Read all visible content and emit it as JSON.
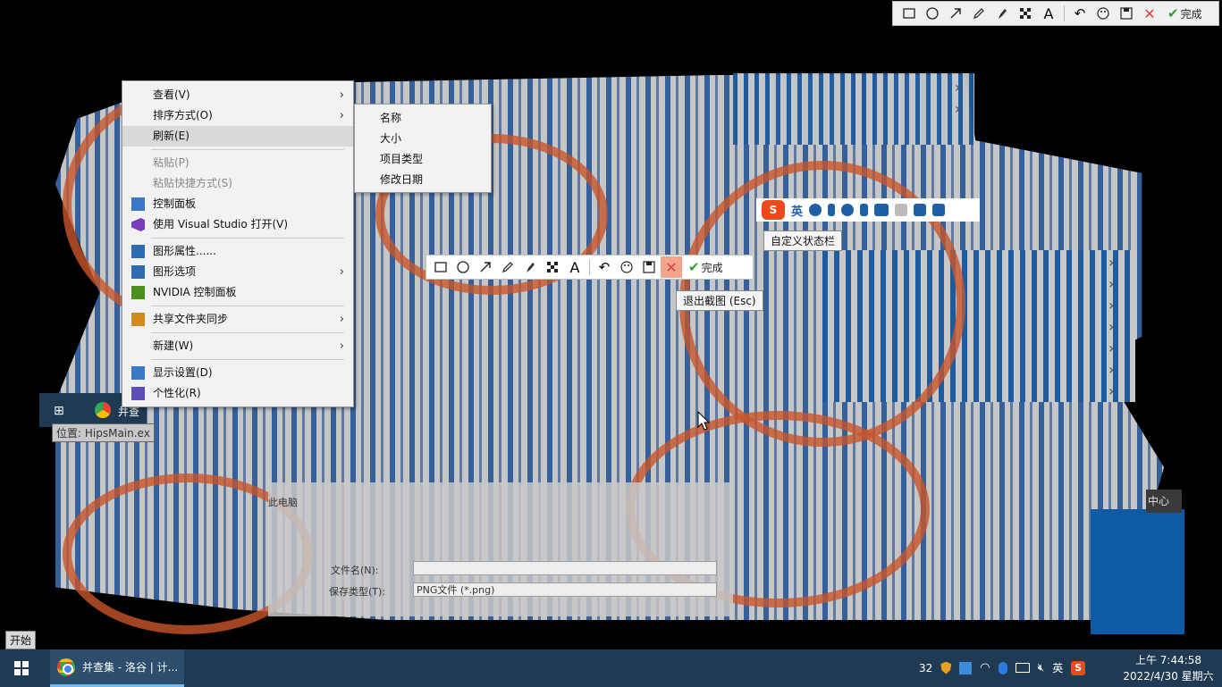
{
  "screenshot_toolbar_top": {
    "tools": [
      "rectangle-icon",
      "ellipse-icon",
      "arrow-icon",
      "pencil-icon",
      "marker-icon",
      "mosaic-icon",
      "text-icon",
      "undo-icon",
      "palette-icon",
      "save-icon",
      "close-icon"
    ],
    "done_label": "完成"
  },
  "context_menu": {
    "items": [
      {
        "label": "查看(V)",
        "submenu": true
      },
      {
        "label": "排序方式(O)",
        "submenu": true
      },
      {
        "label": "刷新(E)"
      },
      {
        "label": "粘贴(P)",
        "disabled": true
      },
      {
        "label": "粘贴快捷方式(S)",
        "disabled": true
      },
      {
        "label": "控制面板",
        "icon": "control-panel-icon"
      },
      {
        "label": "使用 Visual Studio 打开(V)",
        "icon": "visual-studio-icon"
      },
      {
        "label": "图形属性......",
        "icon": "graphics-properties-icon"
      },
      {
        "label": "图形选项",
        "icon": "graphics-options-icon",
        "submenu": true
      },
      {
        "label": "NVIDIA 控制面板",
        "icon": "nvidia-icon"
      },
      {
        "label": "共享文件夹同步",
        "icon": "shared-folder-sync-icon",
        "submenu": true
      },
      {
        "label": "新建(W)",
        "submenu": true
      },
      {
        "label": "显示设置(D)",
        "icon": "display-settings-icon"
      },
      {
        "label": "个性化(R)",
        "icon": "personalize-icon"
      }
    ]
  },
  "sort_submenu": {
    "items": [
      "名称",
      "大小",
      "项目类型",
      "修改日期"
    ]
  },
  "ime_bar": {
    "lang": "英",
    "tooltip": "自定义状态栏"
  },
  "capture_toolbar": {
    "done_label": "完成",
    "close_tooltip": "退出截图 (Esc)"
  },
  "save_dialog": {
    "filename_label": "文件名(N):",
    "filetype_label": "保存类型(T):",
    "filetype_value": "PNG文件 (*.png)",
    "top_label": "此电脑"
  },
  "background_fragments": {
    "start_tip": "开始",
    "position_tip": "位置: HipsMain.ex",
    "mini_task_label": "并查",
    "center_label": "中心"
  },
  "taskbar": {
    "task_label": "并查集 - 洛谷 | 计...",
    "tray_number": "32",
    "ime_lang": "英",
    "time": "上午 7:44:58",
    "date": "2022/4/30 星期六"
  },
  "colors": {
    "taskbar": "#1f3a52",
    "accent": "#76b9ed",
    "done_check": "#2e9e3a",
    "close_x": "#d9433a",
    "swirl": "#c8552a",
    "glitch_blue": "#1e5a9e"
  }
}
